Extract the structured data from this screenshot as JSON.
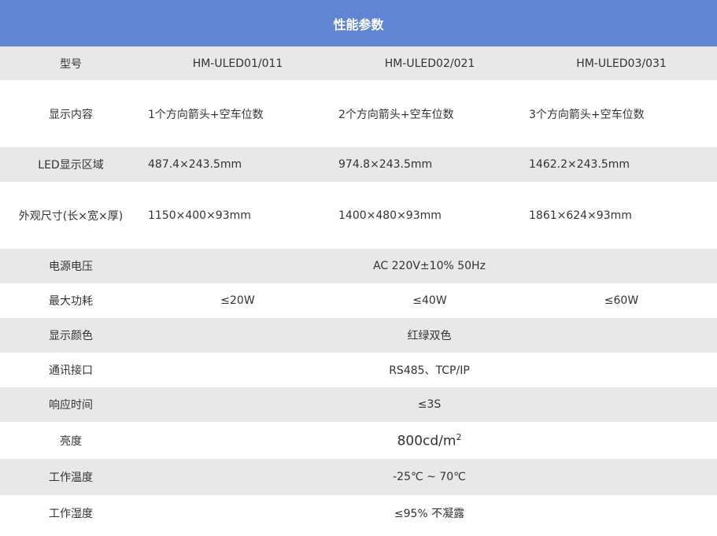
{
  "header": {
    "title": "性能参数"
  },
  "rows": {
    "model": {
      "label": "型号",
      "values": [
        "HM-ULED01/011",
        "HM-ULED02/021",
        "HM-ULED03/031"
      ]
    },
    "display_content": {
      "label": "显示内容",
      "values": [
        "1个方向箭头+空车位数",
        "2个方向箭头+空车位数",
        "3个方向箭头+空车位数"
      ]
    },
    "led_area": {
      "label": "LED显示区域",
      "values": [
        "487.4×243.5mm",
        "974.8×243.5mm",
        "1462.2×243.5mm"
      ]
    },
    "dimensions": {
      "label": "外观尺寸(长×宽×厚)",
      "values": [
        "1150×400×93mm",
        "1400×480×93mm",
        "1861×624×93mm"
      ]
    },
    "voltage": {
      "label": "电源电压",
      "value": "AC 220V±10%  50Hz"
    },
    "power": {
      "label": "最大功耗",
      "values": [
        "≤20W",
        "≤40W",
        "≤60W"
      ]
    },
    "color": {
      "label": "显示颜色",
      "value": "红绿双色"
    },
    "interface": {
      "label": "通讯接口",
      "value": "RS485、TCP/IP"
    },
    "response": {
      "label": "响应时间",
      "value": "≤3S"
    },
    "brightness": {
      "label": "亮度",
      "value": "800cd/m",
      "sup": "2"
    },
    "temperature": {
      "label": "工作温度",
      "value": "-25℃ ~ 70℃"
    },
    "humidity": {
      "label": "工作湿度",
      "value": "≤95% 不凝露"
    }
  }
}
